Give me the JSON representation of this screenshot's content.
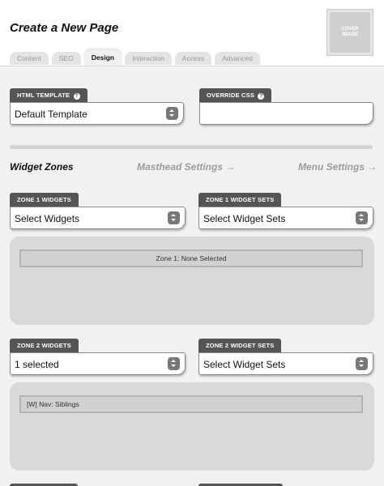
{
  "page": {
    "title": "Create a New Page"
  },
  "tabs": [
    {
      "label": "Content",
      "active": false
    },
    {
      "label": "SEO",
      "active": false
    },
    {
      "label": "Design",
      "active": true
    },
    {
      "label": "Interaction",
      "active": false
    },
    {
      "label": "Access",
      "active": false
    },
    {
      "label": "Advanced",
      "active": false
    }
  ],
  "cover": {
    "label_line1": "COVER",
    "label_line2": "IMAGE"
  },
  "html_template": {
    "label": "HTML TEMPLATE",
    "value": "Default Template",
    "help_icon": "question-circle-icon"
  },
  "override_css": {
    "label": "OVERRIDE CSS",
    "value": "",
    "help_icon": "question-circle-icon"
  },
  "widget_zones": {
    "title": "Widget Zones",
    "masthead_link": "Masthead Settings →",
    "menu_link": "Menu Settings →"
  },
  "zone1": {
    "widgets_label": "ZONE 1 WIDGETS",
    "widgets_value": "Select Widgets",
    "sets_label": "ZONE 1 WIDGET SETS",
    "sets_value": "Select Widget Sets",
    "summary": "Zone 1: None Selected"
  },
  "zone2": {
    "widgets_label": "ZONE 2 WIDGETS",
    "widgets_value": "1 selected",
    "sets_label": "ZONE 2 WIDGET SETS",
    "sets_value": "Select Widget Sets",
    "item": "[W] Nav: Siblings"
  },
  "colors": {
    "label_bg": "#555555",
    "panel_bg": "#d9d9d9",
    "link_gray": "#9c9c9c",
    "page_bg": "#f1f1f1"
  }
}
